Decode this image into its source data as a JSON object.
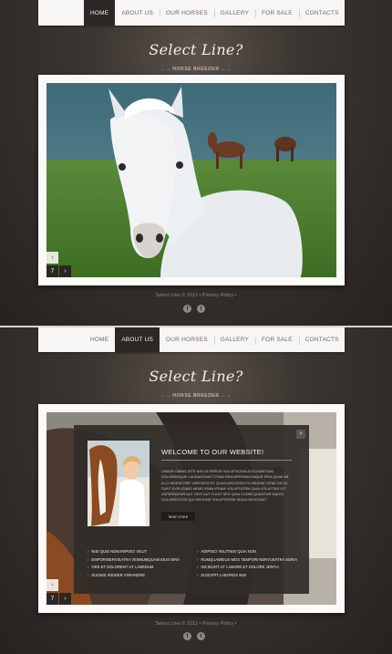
{
  "nav": {
    "items": [
      "HOME",
      "ABOUT US",
      "OUR HORSES",
      "GALLERY",
      "FOR SALE",
      "CONTACTS"
    ]
  },
  "logo": {
    "title": "Select Line",
    "subtitle": "HORSE BREEDER"
  },
  "screen1": {
    "active_item": "HOME",
    "slide_number": "7",
    "prev_icon": "chevron-left-icon",
    "next_icon": "chevron-right-icon"
  },
  "screen2": {
    "active_item": "ABOUT US",
    "slide_number": "7",
    "modal": {
      "title": "WELCOME TO OUR WEBSITE!",
      "text": "Under omnis iste natus error voluptatem accusantium doloremque laudantium totam rem aperiam eaque ipsa quae ab illo inventore veritatis et quasi architecto beatae vitae dicta sunt explicabo nemo enim ipsam voluptatem quia voluptas sit aspernatur aut odit aut fugit sed quia consequuntur magni dolores eos qui ratione voluptatem sequi nesciunt.",
      "button": "learn more",
      "close_icon": "close-icon",
      "list_left": [
        "Nisi quis nonaripisci velit",
        "Emporinervisatra vennumquam eius nira",
        "Ore et dolorent ut labedum",
        "Suonis insider vsrandre"
      ],
      "list_right": [
        "Adipisci velitnisi quia non",
        "Numquameius mos tempori neryusatra keria",
        "Incidunt ut labore et dolore jentia",
        "Suscipit laboros nisi"
      ]
    }
  },
  "footer": {
    "text": "Select Line © 2012 • Privacy Policy •"
  },
  "social": [
    "facebook-icon",
    "twitter-icon"
  ],
  "colors": {
    "background": "#2e2a27",
    "nav_active": "#2b2826",
    "frame": "#fbfaf8"
  }
}
